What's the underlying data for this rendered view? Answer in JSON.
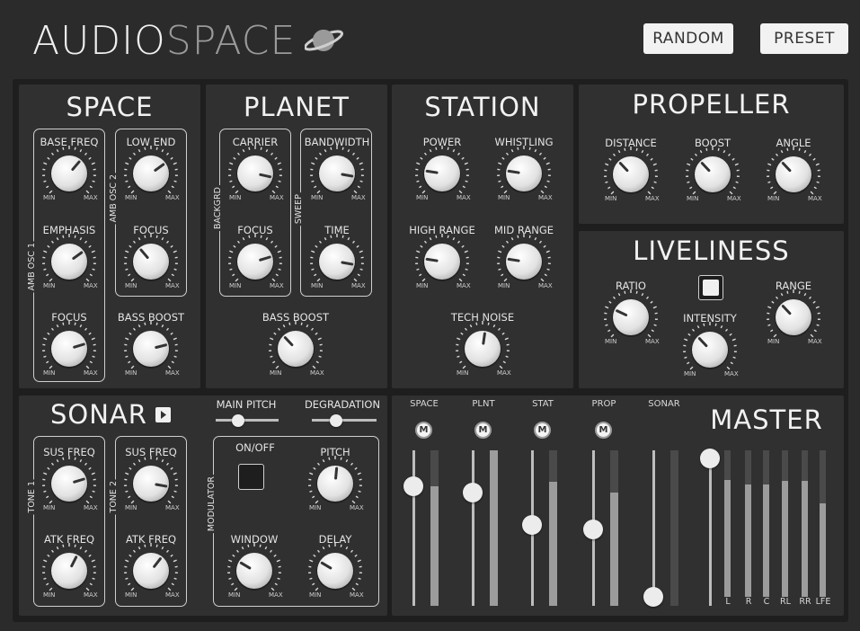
{
  "header": {
    "logo_part1": "AUDIO",
    "logo_part2": "SPACE",
    "logo_icon": "planet-icon",
    "random_label": "RANDOM",
    "preset_label": "PRESET"
  },
  "knob_min": "MIN",
  "knob_max": "MAX",
  "space": {
    "title": "SPACE",
    "group1": "AMB OSC 1",
    "group2": "AMB OSC 2",
    "knobs": [
      {
        "label": "BASE FREQ",
        "value": 0.65
      },
      {
        "label": "EMPHASIS",
        "value": 0.7
      },
      {
        "label": "FOCUS",
        "value": 0.77
      },
      {
        "label": "LOW END",
        "value": 0.7
      },
      {
        "label": "FOCUS",
        "value": 0.35
      },
      {
        "label": "BASS BOOST",
        "value": 0.78
      }
    ]
  },
  "planet": {
    "title": "PLANET",
    "group1": "BACKGRD",
    "group2": "SWEEP",
    "knobs": [
      {
        "label": "CARRIER",
        "value": 0.88
      },
      {
        "label": "FOCUS",
        "value": 0.77
      },
      {
        "label": "BANDWIDTH",
        "value": 0.87
      },
      {
        "label": "TIME",
        "value": 0.87
      },
      {
        "label": "BASS BOOST",
        "value": 0.34
      }
    ]
  },
  "station": {
    "title": "STATION",
    "knobs": [
      {
        "label": "POWER",
        "value": 0.2
      },
      {
        "label": "WHISTLING",
        "value": 0.2
      },
      {
        "label": "HIGH RANGE",
        "value": 0.2
      },
      {
        "label": "MID RANGE",
        "value": 0.2
      },
      {
        "label": "TECH NOISE",
        "value": 0.53
      }
    ]
  },
  "propeller": {
    "title": "PROPELLER",
    "knobs": [
      {
        "label": "DISTANCE",
        "value": 0.34
      },
      {
        "label": "BOOST",
        "value": 0.34
      },
      {
        "label": "ANGLE",
        "value": 0.34
      }
    ]
  },
  "liveliness": {
    "title": "LIVELINESS",
    "toggle_on": true,
    "knobs": [
      {
        "label": "RATIO",
        "value": 0.26
      },
      {
        "label": "INTENSITY",
        "value": 0.34
      },
      {
        "label": "RANGE",
        "value": 0.34
      }
    ]
  },
  "sonar": {
    "title": "SONAR",
    "play_icon": "play-icon",
    "main_pitch_label": "MAIN PITCH",
    "main_pitch_value": 0.35,
    "degradation_label": "DEGRADATION",
    "degradation_value": 0.37,
    "tone1": "TONE 1",
    "tone2": "TONE 2",
    "modulator": "MODULATOR",
    "onoff_label": "ON/OFF",
    "onoff_value": false,
    "knobs": [
      {
        "label": "SUS FREQ",
        "value": 0.77
      },
      {
        "label": "ATK FREQ",
        "value": 0.6
      },
      {
        "label": "SUS FREQ",
        "value": 0.87
      },
      {
        "label": "ATK FREQ",
        "value": 0.64
      },
      {
        "label": "PITCH",
        "value": 0.52
      },
      {
        "label": "WINDOW",
        "value": 0.28
      },
      {
        "label": "DELAY",
        "value": 0.28
      }
    ]
  },
  "mixer": {
    "channels": [
      {
        "label": "SPACE",
        "mute": "M",
        "fader": 0.77,
        "meter": 0.77
      },
      {
        "label": "PLNT",
        "mute": "M",
        "fader": 0.73,
        "meter": 1.0
      },
      {
        "label": "STAT",
        "mute": "M",
        "fader": 0.52,
        "meter": 0.8
      },
      {
        "label": "PROP",
        "mute": "M",
        "fader": 0.49,
        "meter": 0.73
      },
      {
        "label": "SONAR",
        "mute": "",
        "fader": 0.06,
        "meter": 0.0
      }
    ],
    "master": {
      "title": "MASTER",
      "fader": 0.95,
      "meters": [
        {
          "label": "L",
          "value": 0.8
        },
        {
          "label": "R",
          "value": 0.77
        },
        {
          "label": "C",
          "value": 0.77
        },
        {
          "label": "RL",
          "value": 0.79
        },
        {
          "label": "RR",
          "value": 0.79
        },
        {
          "label": "LFE",
          "value": 0.64
        }
      ]
    }
  },
  "colors": {
    "background": "#2b2b2b",
    "frame": "#1e1e1e",
    "panel": "#303030",
    "knob": "#e6e6e6",
    "accent": "#f2f2f2"
  }
}
